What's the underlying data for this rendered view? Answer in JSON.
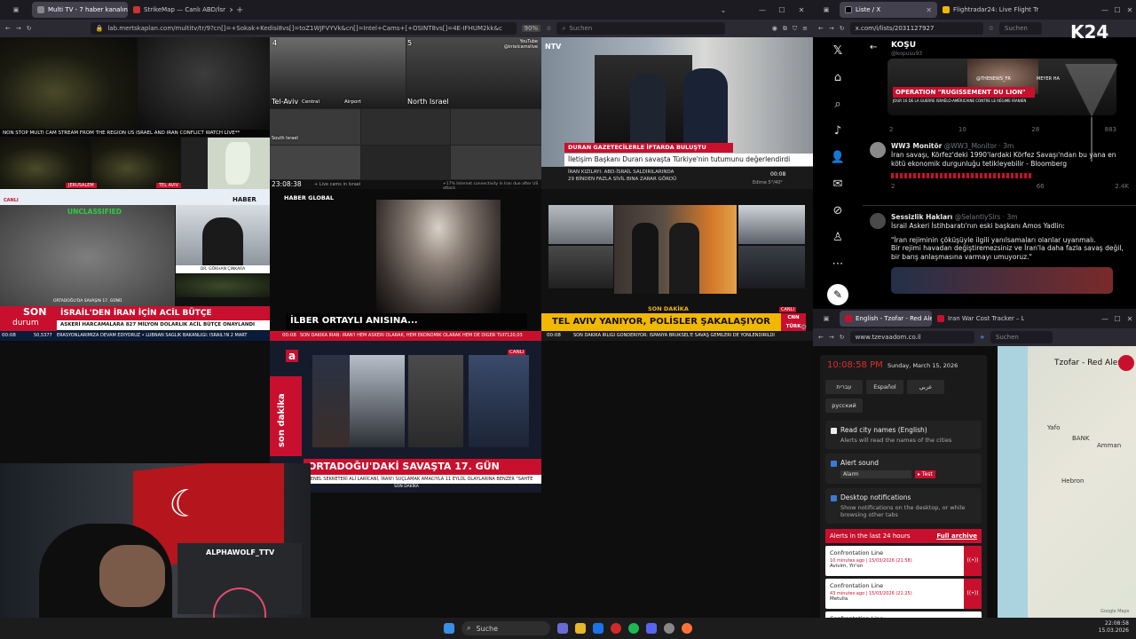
{
  "left_browser": {
    "tabs": [
      {
        "label": "Multi TV - 7 haber kanalını"
      },
      {
        "label": "StrikeMap — Canlı ABD/İsr"
      }
    ],
    "url": "lab.mertskaplan.com/multitv/tr/9?cn[]=+Sokak+Kedisi8vs[]=toZ1WJFVYVk&cn[]=Intel+Cams+[+OSINT8vs[]=4E-IFHUM2kk&c",
    "zoom": "90%",
    "search_placeholder": "Suchen"
  },
  "tiles": {
    "t1": {
      "banner": "NON STOP MULTI CAM STREAM FROM THE REGION US ISRAEL AND IRAN CONFLICT WATCH LIVE**",
      "tag_a": "JERUSALEM",
      "tag_b": "TEL AVIV"
    },
    "t2": {
      "cam4": "4",
      "cam5": "5",
      "tel_aviv": "Tel-Aviv",
      "central": "Central",
      "airport": "Airport",
      "north": "North Israel",
      "south": "South Israel",
      "time": "23:08:38",
      "source": "YouTube @intelcamslive",
      "footer": "+ Live cams in Israel",
      "footer2": "+17% Internet connectivity in Iran due after US attack"
    },
    "t3": {
      "logo": "NTV",
      "headline1": "DURAN GAZETECİLERLE İFTARDA BULUŞTU",
      "headline2": "İletişim Başkanı Duran savaşta Türkiye'nin tutumunu değerlendirdi",
      "sub1": "İRAN KIZILAYI: ABD-İSRAİL SALDIRILARINDA",
      "sub2": "29 BİNDEN FAZLA SİVİL BINA ZARAR GÖRDÜ",
      "clock": "00:08",
      "weather": "Edirne 5°/40°"
    },
    "t4": {
      "tag": "UNCLASSIFIED",
      "channel": "HABER",
      "badge": "CANLI",
      "guest": "DR. GÖKHAN ÇINKARA",
      "caption": "ORTADOĞU'DA SAVAŞIN 17. GÜNÜ",
      "son": "SON",
      "durum": "durum",
      "headline": "İSRAİL'DEN İRAN İÇİN ACİL BÜTÇE",
      "sub": "ASKERİ HARCAMALARA 827 MİLYON DOLARLIK ACİL BÜTÇE ONAYLANDI",
      "ticker": "ERASYONLARIMIZA DEVAM EDİYORUZ  •  LÜBNAN SAĞLIK BAKANLIĞI: İSRAİL'İN 2 MART",
      "clock": "00:08",
      "value": "50,5377"
    },
    "t5": {
      "logo": "HABER GLOBAL",
      "caption": "İLBER ORTAYLI ANISINA...",
      "ticker": "SON DAKİKA  İRAN: İRAN'I HEM ASKERİ OLARAK, HEM EKONOMİK OLARAK HEM DE DİĞER TÜR",
      "clock": "00:08",
      "bist": "7120,03"
    },
    "t6": {
      "badge": "CANLI",
      "section": "SON DAKİKA",
      "headline": "TEL AVIV YANIYOR, POLİSLER ŞAKALAŞIYOR",
      "logo": "CNN TÜRK",
      "ticker": "SON DAKİKA  IRLIĞI GÖNDERİYOR: İSPANYA BRÜKSEL'E SAVAŞ GEMİLERİ DE YÖNLENDİRİLDİ",
      "clock": "00:08"
    },
    "t7": {
      "logo": "a",
      "badge": "CANLI",
      "side": "son dakika",
      "headline": "ORTADOĞU'DAKİ SAVAŞTA 17. GÜN",
      "ticker": "GENEL SEKRETERİ ALİ LARİCANİ, İRAN'I SUÇLAMAK AMACIYLA 11 EYLÜL OLAYLARINA BENZER \"SAHTE",
      "clock": "SON DAKİKA"
    }
  },
  "streamer": {
    "handle": "ALPHAWOLF_TTV"
  },
  "right_browser": {
    "tabs": [
      {
        "label": "Liste / X"
      },
      {
        "label": "Flightradar24: Live Flight Tr"
      }
    ],
    "url": "x.com/i/lists/2031127927",
    "search_placeholder": "Suchen",
    "logo": "K24",
    "list_title": "KOŞU",
    "list_handle": "@kopusu93",
    "video_text1": "OPERATION \"RUGISSEMENT DU LION\"",
    "video_text2": "JOUR 16 DE LA GUERRE ISRAËLO-AMÉRICAINE CONTRE LE RÉGIME IRANIEN",
    "video_text3": "@THENEWS_FR",
    "video_text4": "MEYER HA",
    "video_stats": [
      "2",
      "10",
      "28",
      "883"
    ],
    "tweets": [
      {
        "name": "WW3 Monitör",
        "handle": "@WW3_Monitor · 3m",
        "text": "İran savaşı, Körfez'deki 1990'lardaki Körfez Savaşı'ndan bu yana en kötü ekonomik durgunluğu tetikleyebilir - Bloomberg",
        "stats": [
          "2",
          "",
          "66",
          "2.4K"
        ]
      },
      {
        "name": "Sessizlik Hakları",
        "handle": "@SelantlySlrs · 3m",
        "text1": "İsrail Askeri İstihbaratı'nın eski başkanı Amos Yadlin:",
        "text2": "\"İran rejiminin çöküşüyle ilgili yanılsamaları olanlar uyanmalı.",
        "text3": "Bir rejimi havadan değiştiremezsiniz ve İran'la daha fazla savaş değil, bir barış anlaşmasına varmayı umuyoruz.\""
      }
    ]
  },
  "tzofar": {
    "tabs": [
      {
        "label": "English - Tzofar - Red Alert"
      },
      {
        "label": "Iran War Cost Tracker – Liv"
      }
    ],
    "url": "www.tzevaadom.co.il",
    "search_placeholder": "Suchen",
    "time": "10:08:58 PM",
    "date": "Sunday, March 15, 2026",
    "languages": [
      "עברית",
      "Español",
      "عربي",
      "русский"
    ],
    "opt1_title": "Read city names (English)",
    "opt1_sub": "Alerts will read the names of the cities",
    "opt2_title": "Alert sound",
    "opt2_select": "Alarm",
    "opt2_test": "▸ Test",
    "opt3_title": "Desktop notifications",
    "opt3_sub": "Show notifications on the desktop, or while browsing other tabs",
    "alerts_title": "Alerts in the last 24 hours",
    "alerts_link": "Full archive",
    "alerts": [
      {
        "title": "Confrontation Line",
        "time": "10 minutes ago | 15/03/2026 (21:58)",
        "place": "Avivim, Yir'on"
      },
      {
        "title": "Confrontation Line",
        "time": "43 minutes ago | 15/03/2026 (21:25)",
        "place": "Metulla"
      },
      {
        "title": "Confrontation Line",
        "time": "",
        "place": ""
      }
    ],
    "map_title": "Tzofar - Red Alert",
    "map_labels": [
      "Yafo",
      "BANK",
      "Amman",
      "Hebron",
      "Google Maps"
    ]
  },
  "taskbar": {
    "search": "Suche",
    "time": "22:08:58",
    "date": "15.03.2026"
  }
}
